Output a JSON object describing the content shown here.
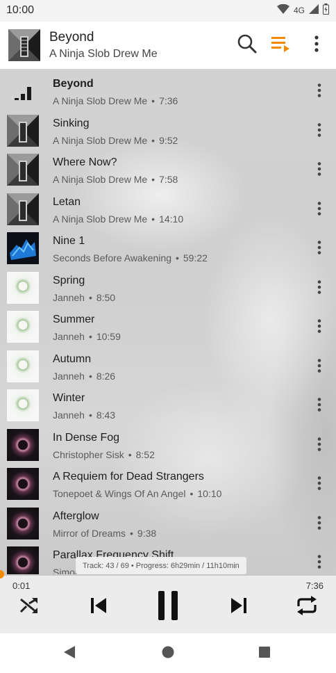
{
  "status_bar": {
    "time": "10:00",
    "network": "4G",
    "wifi_icon": "wifi-icon",
    "signal_icon": "signal-icon",
    "battery_icon": "battery-icon"
  },
  "header": {
    "title": "Beyond",
    "subtitle": "A Ninja Slob Drew Me",
    "search_icon": "search-icon",
    "queue_icon": "playlist-play-icon",
    "more_icon": "more-vert-icon",
    "accent": "#f28a00"
  },
  "tracks": [
    {
      "title": "Beyond",
      "artist": "A Ninja Slob Drew Me",
      "duration": "7:36",
      "current": true
    },
    {
      "title": "Sinking",
      "artist": "A Ninja Slob Drew Me",
      "duration": "9:52"
    },
    {
      "title": "Where Now?",
      "artist": "A Ninja Slob Drew Me",
      "duration": "7:58"
    },
    {
      "title": "Letan",
      "artist": "A Ninja Slob Drew Me",
      "duration": "14:10"
    },
    {
      "title": "Nine 1",
      "artist": "Seconds Before Awakening",
      "duration": "59:22"
    },
    {
      "title": "Spring",
      "artist": "Janneh",
      "duration": "8:50"
    },
    {
      "title": "Summer",
      "artist": "Janneh",
      "duration": "10:59"
    },
    {
      "title": "Autumn",
      "artist": "Janneh",
      "duration": "8:26"
    },
    {
      "title": "Winter",
      "artist": "Janneh",
      "duration": "8:43"
    },
    {
      "title": "In Dense Fog",
      "artist": "Christopher Sisk",
      "duration": "8:52"
    },
    {
      "title": "A Requiem for Dead Strangers",
      "artist": "Tonepoet & Wings Of An Angel",
      "duration": "10:10"
    },
    {
      "title": "Afterglow",
      "artist": "Mirror of Dreams",
      "duration": "9:38"
    },
    {
      "title": "Parallax Frequency Shift",
      "artist": "Simor",
      "duration": ""
    }
  ],
  "tooltip": "Track: 43 / 69 • Progress: 6h29min / 11h10min",
  "player": {
    "elapsed": "0:01",
    "duration": "7:36",
    "progress_fraction": 0.002,
    "shuffle_icon": "shuffle-icon",
    "previous_icon": "skip-previous-icon",
    "pause_icon": "pause-icon",
    "next_icon": "skip-next-icon",
    "repeat_icon": "repeat-icon"
  },
  "navbar": {
    "back_icon": "back-triangle-icon",
    "home_icon": "home-circle-icon",
    "recents_icon": "recents-square-icon"
  }
}
